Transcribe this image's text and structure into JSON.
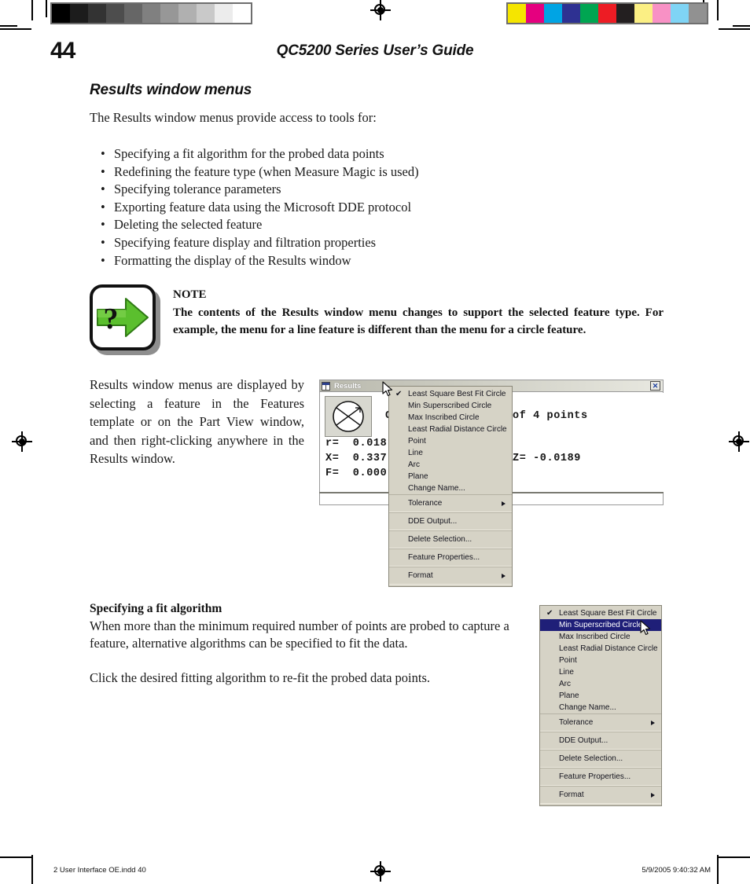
{
  "page": {
    "number": "44",
    "running_head": "QC5200 Series User’s Guide"
  },
  "section": {
    "title": "Results window menus",
    "intro": "The Results window menus provide access to tools for:",
    "bullets": [
      "Specifying a fit algorithm for the probed data points",
      "Redefining the feature type (when Measure Magic is used)",
      "Specifying tolerance parameters",
      "Exporting feature data using the Microsoft DDE protocol",
      "Deleting the selected feature",
      "Specifying feature display and filtration properties",
      "Formatting the display of the Results window"
    ],
    "bullet_char": "•"
  },
  "note": {
    "label": "NOTE",
    "text": "The contents of the Results window menu changes to support the selected feature type. For example, the menu for a line feature is different than the menu for a circle feature.",
    "icon_colors": {
      "arrow_fill": "#5bbf2e",
      "arrow_dark": "#3f9a1c",
      "frame": "#111111",
      "shadow": "#8e8e8e"
    }
  },
  "figure1": {
    "caption": "Results window menus are displayed by selecting a feature in the Features template or on the Part View window, and then right-clicking anywhere in the Results window.",
    "window": {
      "title": "Results",
      "close_label": "✕",
      "feature_label": "Ci",
      "points_label": "of 4 points",
      "values": [
        {
          "name": "r",
          "text": "r=  0.018"
        },
        {
          "name": "X",
          "text": "X=  0.337"
        },
        {
          "name": "F",
          "text": "F=  0.000"
        }
      ],
      "z_value": "Z= -0.0189"
    }
  },
  "context_menu": {
    "items": [
      {
        "label": "Least Square Best Fit Circle",
        "checked": true,
        "submenu": false,
        "selected": false,
        "grouped": false
      },
      {
        "label": "Min Superscribed Circle",
        "checked": false,
        "submenu": false,
        "selected": false,
        "grouped": false
      },
      {
        "label": "Max Inscribed Circle",
        "checked": false,
        "submenu": false,
        "selected": false,
        "grouped": false
      },
      {
        "label": "Least Radial Distance Circle",
        "checked": false,
        "submenu": false,
        "selected": false,
        "grouped": false
      },
      {
        "label": "Point",
        "checked": false,
        "submenu": false,
        "selected": false,
        "grouped": false
      },
      {
        "label": "Line",
        "checked": false,
        "submenu": false,
        "selected": false,
        "grouped": false
      },
      {
        "label": "Arc",
        "checked": false,
        "submenu": false,
        "selected": false,
        "grouped": false
      },
      {
        "label": "Plane",
        "checked": false,
        "submenu": false,
        "selected": false,
        "grouped": false
      },
      {
        "label": "Change Name...",
        "checked": false,
        "submenu": false,
        "selected": false,
        "grouped": false
      },
      {
        "label": "Tolerance",
        "checked": false,
        "submenu": true,
        "selected": false,
        "grouped": true
      },
      {
        "label": "DDE Output...",
        "checked": false,
        "submenu": false,
        "selected": false,
        "grouped": true
      },
      {
        "label": "Delete Selection...",
        "checked": false,
        "submenu": false,
        "selected": false,
        "grouped": true
      },
      {
        "label": "Feature Properties...",
        "checked": false,
        "submenu": false,
        "selected": false,
        "grouped": true
      },
      {
        "label": "Format",
        "checked": false,
        "submenu": true,
        "selected": false,
        "grouped": true
      }
    ],
    "check_glyph": "✔",
    "highlight_color": "#1f1f78",
    "background_color": "#d6d3c6"
  },
  "context_menu_2": {
    "selected_label": "Min Superscribed Circle"
  },
  "fit_section": {
    "title": "Specifying a fit algorithm",
    "paragraph1": "When more than the minimum required number of points are probed to capture a feature, alternative algorithms can be specified to fit the data.",
    "paragraph2": "Click the desired fitting algorithm to re-fit the probed data points."
  },
  "footer": {
    "left": "2 User Interface OE.indd   40",
    "right": "5/9/2005   9:40:32 AM"
  },
  "press_marks": {
    "grayscale": [
      "#000000",
      "#1c1c1c",
      "#333333",
      "#4d4d4d",
      "#666666",
      "#808080",
      "#979797",
      "#b0b0b0",
      "#c9c9c9",
      "#ececec",
      "#ffffff"
    ],
    "colorbar": [
      "#f5e500",
      "#e5007f",
      "#00a4e4",
      "#2e3192",
      "#00a551",
      "#ed1c24",
      "#231f20",
      "#fbef84",
      "#f891c5",
      "#7fd4f5",
      "#919191"
    ]
  }
}
